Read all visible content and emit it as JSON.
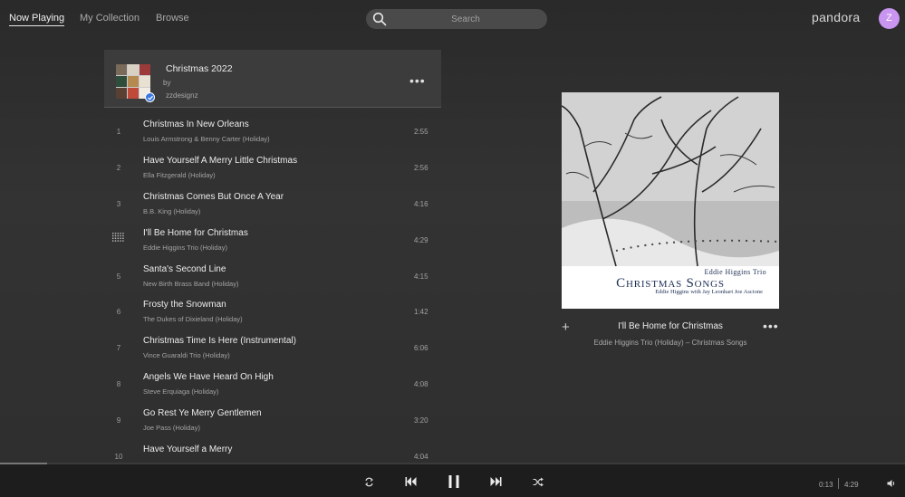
{
  "nav": {
    "tabs": [
      {
        "label": "Now Playing",
        "active": true
      },
      {
        "label": "My Collection",
        "active": false
      },
      {
        "label": "Browse",
        "active": false
      }
    ],
    "search_placeholder": "Search",
    "brand": "pandora",
    "avatar_letter": "Z",
    "avatar_color": "#c995f0"
  },
  "playlist": {
    "title": "Christmas 2022",
    "by_label": "by",
    "owner": "zzdesignz",
    "tracks": [
      {
        "num": "1",
        "title": "Christmas In New Orleans",
        "artist": "Louis Armstrong & Benny Carter (Holiday)",
        "duration": "2:55"
      },
      {
        "num": "2",
        "title": "Have Yourself A Merry Little Christmas",
        "artist": "Ella Fitzgerald (Holiday)",
        "duration": "2:56"
      },
      {
        "num": "3",
        "title": "Christmas Comes But Once A Year",
        "artist": "B.B. King (Holiday)",
        "duration": "4:16"
      },
      {
        "num": "",
        "title": "I'll Be Home for Christmas",
        "artist": "Eddie Higgins Trio (Holiday)",
        "duration": "4:29",
        "playing": true
      },
      {
        "num": "5",
        "title": "Santa's Second Line",
        "artist": "New Birth Brass Band (Holiday)",
        "duration": "4:15"
      },
      {
        "num": "6",
        "title": "Frosty the Snowman",
        "artist": "The Dukes of Dixieland (Holiday)",
        "duration": "1:42"
      },
      {
        "num": "7",
        "title": "Christmas Time Is Here (Instrumental)",
        "artist": "Vince Guaraldi Trio (Holiday)",
        "duration": "6:06"
      },
      {
        "num": "8",
        "title": "Angels We Have Heard On High",
        "artist": "Steve Erquiaga (Holiday)",
        "duration": "4:08"
      },
      {
        "num": "9",
        "title": "Go Rest Ye Merry Gentlemen",
        "artist": "Joe Pass (Holiday)",
        "duration": "3:20"
      },
      {
        "num": "10",
        "title": "Have Yourself a Merry",
        "artist": "",
        "duration": "4:04"
      }
    ]
  },
  "now_playing": {
    "album_artist": "Eddie Higgins Trio",
    "album_title": "Christmas Songs",
    "album_subtitle": "Eddie Higgins with Jay Leonhart Joe Ascione",
    "track_title": "I'll Be Home for Christmas",
    "track_sub": "Eddie Higgins Trio (Holiday) – Christmas Songs"
  },
  "player": {
    "elapsed": "0:13",
    "total": "4:29",
    "progress_fraction": 0.052
  }
}
